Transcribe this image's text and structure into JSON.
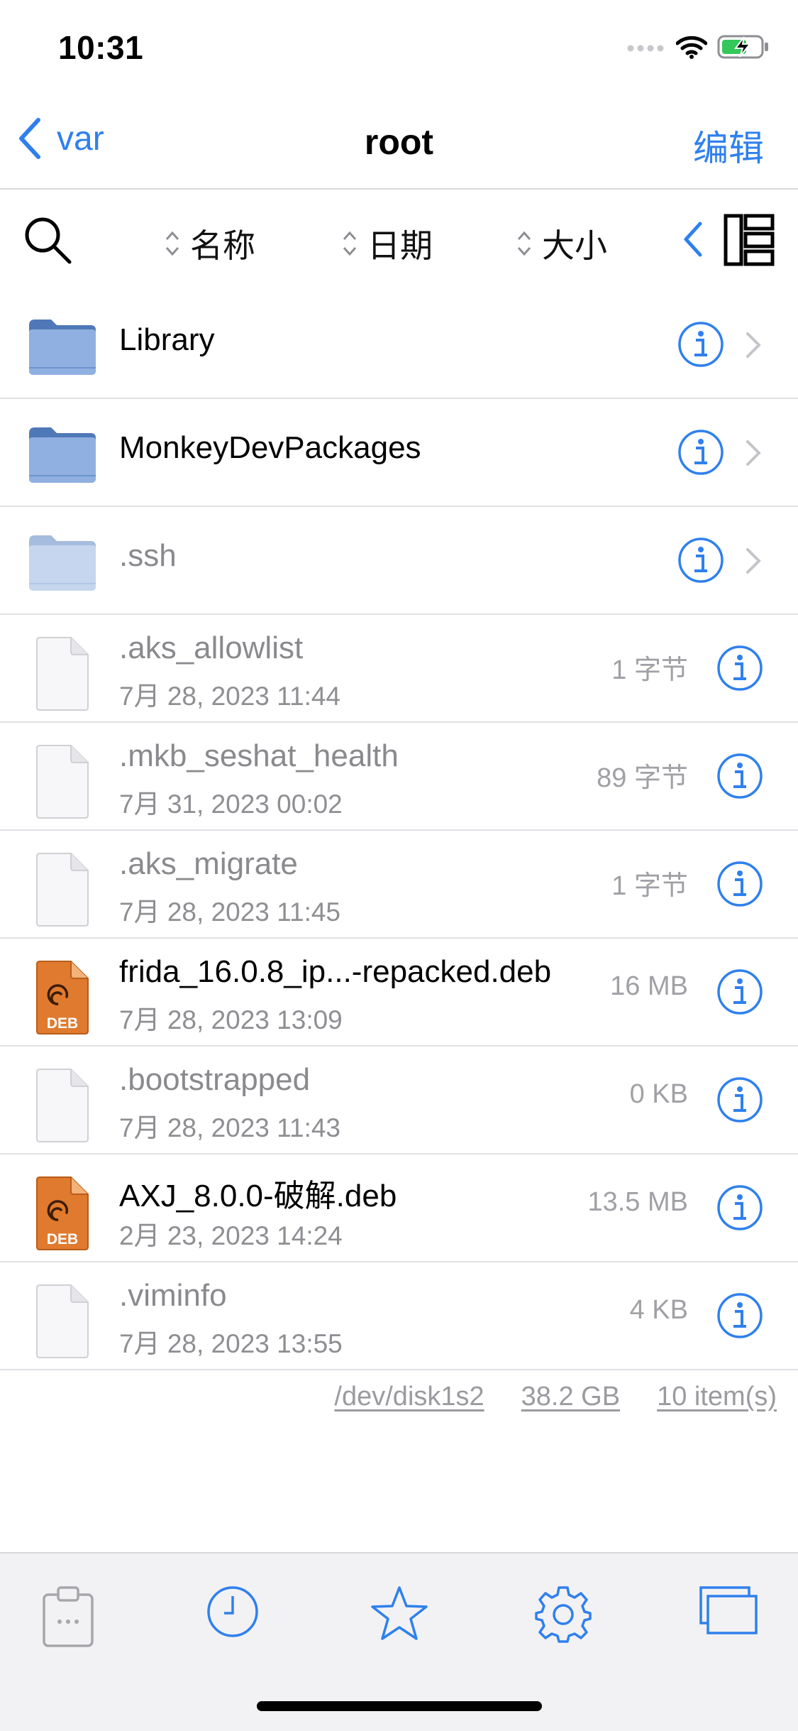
{
  "status": {
    "time": "10:31"
  },
  "nav": {
    "back_label": "var",
    "title": "root",
    "edit_label": "编辑"
  },
  "toolbar": {
    "sort_name": "名称",
    "sort_date": "日期",
    "sort_size": "大小"
  },
  "items": [
    {
      "type": "folder",
      "name": "Library"
    },
    {
      "type": "folder",
      "name": "MonkeyDevPackages"
    },
    {
      "type": "folder",
      "name": ".ssh",
      "dim": true
    },
    {
      "type": "file",
      "name": ".aks_allowlist",
      "date": "7月 28, 2023 11:44",
      "size": "1 字节",
      "dim": true
    },
    {
      "type": "file",
      "name": ".mkb_seshat_health",
      "date": "7月 31, 2023 00:02",
      "size": "89 字节",
      "dim": true
    },
    {
      "type": "file",
      "name": ".aks_migrate",
      "date": "7月 28, 2023 11:45",
      "size": "1 字节",
      "dim": true
    },
    {
      "type": "deb",
      "name": "frida_16.0.8_ip...-repacked.deb",
      "date": "7月 28, 2023 13:09",
      "size": "16 MB",
      "badge": "DEB"
    },
    {
      "type": "file",
      "name": ".bootstrapped",
      "date": "7月 28, 2023 11:43",
      "size": "0 KB",
      "dim": true
    },
    {
      "type": "deb",
      "name": "AXJ_8.0.0-破解.deb",
      "date": "2月 23, 2023 14:24",
      "size": "13.5 MB",
      "badge": "DEB"
    },
    {
      "type": "file",
      "name": ".viminfo",
      "date": "7月 28, 2023 13:55",
      "size": "4 KB",
      "dim": true
    }
  ],
  "footer": {
    "disk": "/dev/disk1s2",
    "capacity": "38.2 GB",
    "count": "10 item(s)"
  },
  "tabs": [
    {
      "icon": "clipboard-icon"
    },
    {
      "icon": "clock-icon"
    },
    {
      "icon": "star-icon"
    },
    {
      "icon": "gear-icon"
    },
    {
      "icon": "windows-icon"
    }
  ],
  "colors": {
    "accent": "#2f80ed",
    "folder": "#8fb0e0",
    "folder_dim": "#c6d6ee",
    "deb": "#e07a2e"
  }
}
